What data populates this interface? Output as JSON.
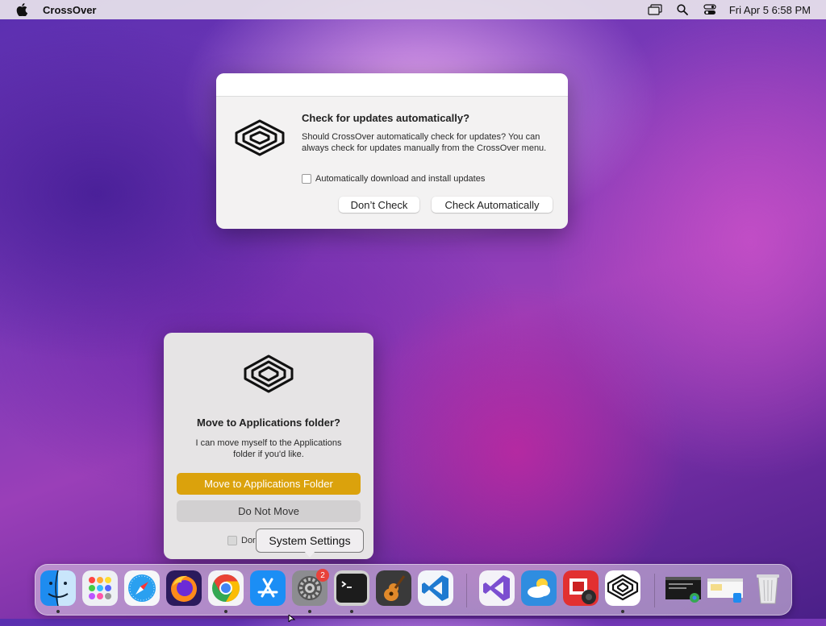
{
  "menubar": {
    "app_name": "CrossOver",
    "clock": "Fri Apr 5  6:58 PM"
  },
  "update_dialog": {
    "title": "Check for updates automatically?",
    "body": "Should CrossOver automatically check for updates? You can always check for updates manually from the CrossOver menu.",
    "checkbox_label": "Automatically download and install updates",
    "dont_check_label": "Don’t Check",
    "check_auto_label": "Check Automatically"
  },
  "move_dialog": {
    "title": "Move to Applications folder?",
    "body": "I can move myself to the Applications folder if you'd like.",
    "primary_label": "Move to Applications Folder",
    "secondary_label": "Do Not Move",
    "checkbox_label_partial": "Dor"
  },
  "tooltip": {
    "text": "System Settings"
  },
  "dock": {
    "settings_badge": "2",
    "apps": [
      "Finder",
      "Launchpad",
      "Safari",
      "Firefox",
      "Google Chrome",
      "App Store",
      "System Settings",
      "Terminal",
      "GarageBand",
      "Visual Studio Code",
      "Visual Studio",
      "Weather",
      "Photo Booth",
      "CrossOver",
      "Chrome window",
      "Finder window",
      "Trash"
    ]
  },
  "colors": {
    "accent_primary": "#dba20c",
    "badge": "#e8413a"
  }
}
